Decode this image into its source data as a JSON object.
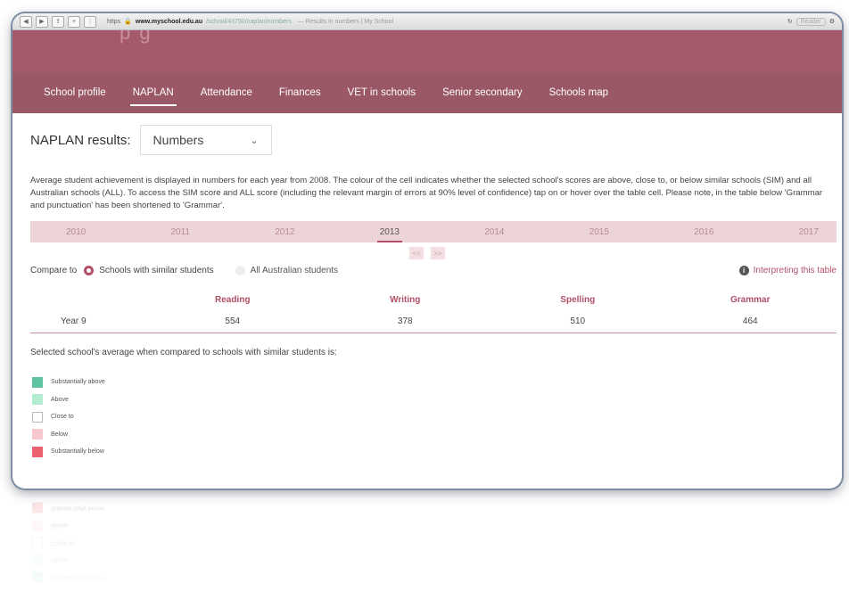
{
  "browser": {
    "url_protocol": "https",
    "url_domain": "www.myschool.edu.au",
    "url_path": "/school/43750/naplan/numbers",
    "page_title": "— Results in numbers | My School",
    "reader_label": "Reader"
  },
  "nav": {
    "items": [
      {
        "label": "School profile",
        "active": false
      },
      {
        "label": "NAPLAN",
        "active": true
      },
      {
        "label": "Attendance",
        "active": false
      },
      {
        "label": "Finances",
        "active": false
      },
      {
        "label": "VET in schools",
        "active": false
      },
      {
        "label": "Senior secondary",
        "active": false
      },
      {
        "label": "Schools map",
        "active": false
      }
    ]
  },
  "results": {
    "label": "NAPLAN results:",
    "selected": "Numbers"
  },
  "description": "Average student achievement is displayed in numbers for each year from 2008. The colour of the cell indicates whether the selected school's scores are above, close to, or below similar schools (SIM) and all Australian schools (ALL). To access the SIM score and ALL score (including the relevant margin of errors at 90% level of confidence) tap on or hover over the table cell. Please note, in the table below 'Grammar and punctuation' has been shortened to 'Grammar'.",
  "years": [
    "2010",
    "2011",
    "2012",
    "2013",
    "2014",
    "2015",
    "2016",
    "2017"
  ],
  "active_year": "2013",
  "pager": {
    "prev": "<<",
    "next": ">>"
  },
  "compare": {
    "label": "Compare to",
    "options": [
      {
        "label": "Schools with similar students",
        "selected": true
      },
      {
        "label": "All Australian students",
        "selected": false
      }
    ],
    "interpreting": "Interpreting this table"
  },
  "table": {
    "headers": [
      "Reading",
      "Writing",
      "Spelling",
      "Grammar"
    ],
    "rows": [
      {
        "label": "Year 9",
        "values": [
          "554",
          "378",
          "510",
          "464"
        ]
      }
    ]
  },
  "legend": {
    "title": "Selected school's average when compared to schools with similar students is:",
    "items": [
      {
        "label": "Substantially above",
        "color": "#5fc49f"
      },
      {
        "label": "Above",
        "color": "#b4ecd2"
      },
      {
        "label": "Close to",
        "color": "#ffffff"
      },
      {
        "label": "Below",
        "color": "#f6c7cc"
      },
      {
        "label": "Substantially below",
        "color": "#e9616f"
      }
    ]
  },
  "colors": {
    "banner": "#a45a6a",
    "nav": "#9a5766",
    "accent": "#b05066",
    "year_bar": "#ecd4d8"
  }
}
